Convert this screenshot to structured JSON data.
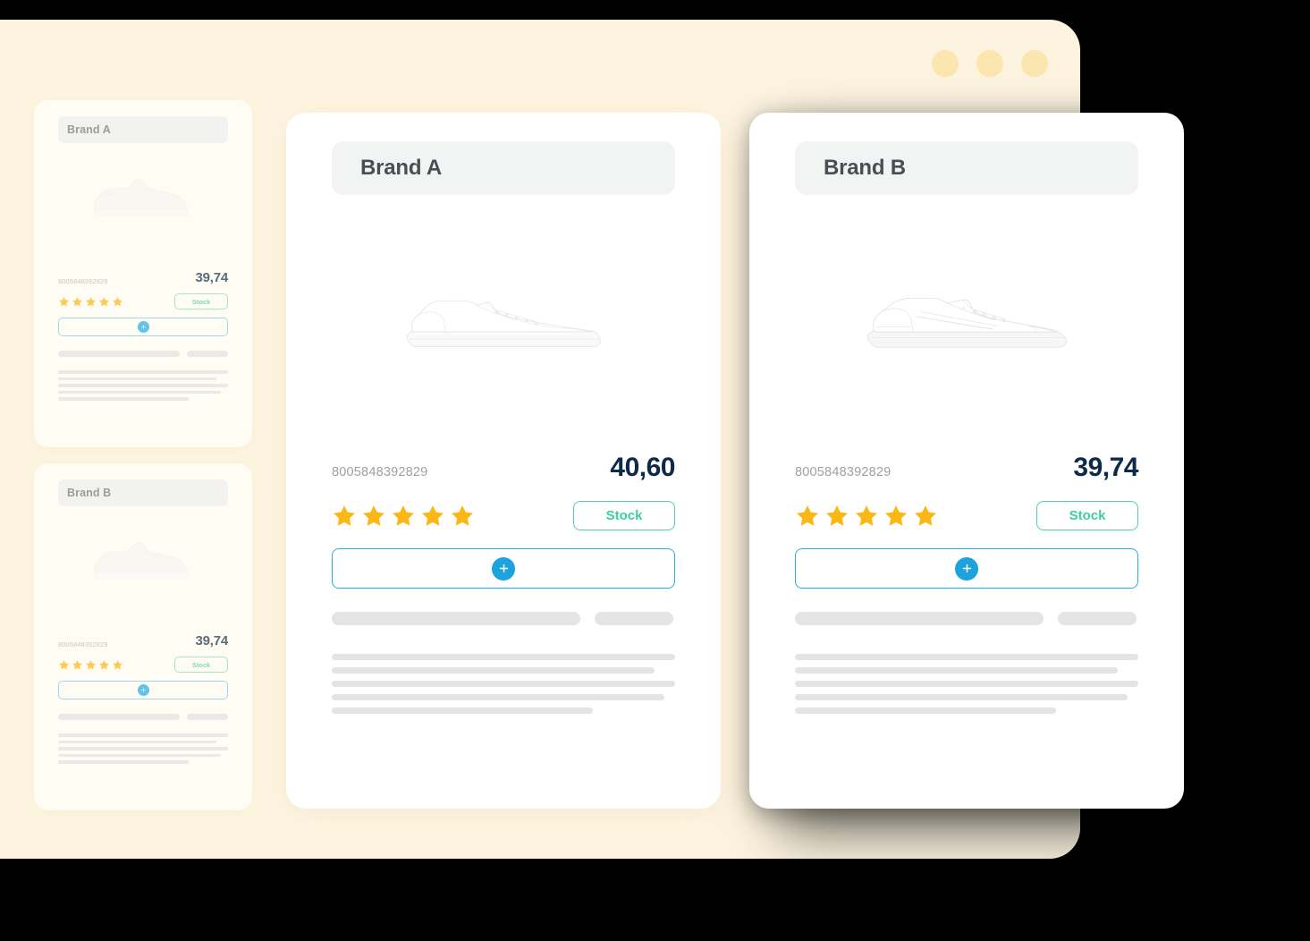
{
  "window": {
    "dots": [
      "chrome-dot-1",
      "chrome-dot-2",
      "chrome-dot-3"
    ],
    "background_color": "#FDF4E0"
  },
  "colors": {
    "page_background": "#FDF4E0",
    "card_background": "#FFFFFF",
    "brand_pill": "#F2F4F4",
    "star": "#FBB713",
    "stock_accent": "#3ECF9E",
    "add_accent": "#1CA2DC",
    "price_text": "#0D2A4A",
    "sku_text": "#9EA0A3",
    "skeleton": "#E4E4E4"
  },
  "sidebar": {
    "items": [
      {
        "brand": "Brand A",
        "sku": "8005848392829",
        "price": "39,74",
        "rating": 5,
        "stock_label": "Stock",
        "add_label": "+",
        "product_image": "white-sneaker"
      },
      {
        "brand": "Brand B",
        "sku": "8005848392829",
        "price": "39,74",
        "rating": 5,
        "stock_label": "Stock",
        "add_label": "+",
        "product_image": "white-sneaker"
      }
    ]
  },
  "cards": [
    {
      "brand": "Brand A",
      "sku": "8005848392829",
      "price": "40,60",
      "rating": 5,
      "stock_label": "Stock",
      "add_label": "+",
      "product_image": "white-low-top-sneaker"
    },
    {
      "brand": "Brand B",
      "sku": "8005848392829",
      "price": "39,74",
      "rating": 5,
      "stock_label": "Stock",
      "add_label": "+",
      "product_image": "white-court-sneaker"
    }
  ]
}
